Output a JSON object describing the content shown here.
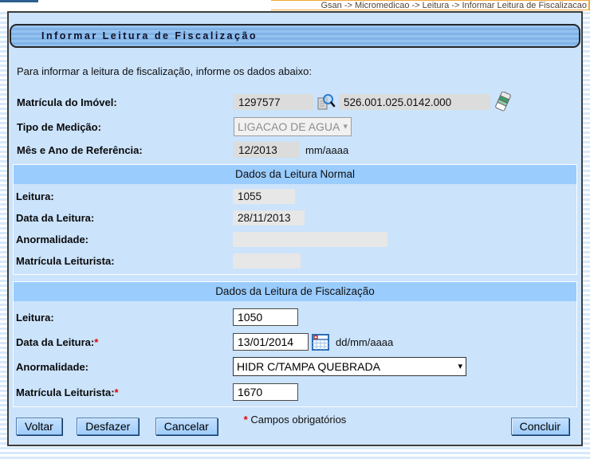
{
  "breadcrumb": "Gsan -> Micromedicao -> Leitura -> Informar Leitura de Fiscalizacao",
  "title_bar": {
    "title": "Informar Leitura de Fiscalização"
  },
  "intro_text": "Para informar a leitura de fiscalização, informe os dados abaixo:",
  "fields": {
    "matricula_imovel": {
      "label": "Matrícula do Imóvel:",
      "value": "1297577",
      "inscricao": "526.001.025.0142.000"
    },
    "tipo_medicao": {
      "label": "Tipo de Medição:",
      "value": "LIGACAO DE AGUA"
    },
    "mes_ano_referencia": {
      "label": "Mês e Ano de Referência:",
      "value": "12/2013",
      "hint": "mm/aaaa"
    }
  },
  "normal_section": {
    "header": "Dados da Leitura Normal",
    "leitura": {
      "label": "Leitura:",
      "value": "1055"
    },
    "data_leitura": {
      "label": "Data da Leitura:",
      "value": "28/11/2013"
    },
    "anormalidade": {
      "label": "Anormalidade:",
      "value": ""
    },
    "matricula_leiturista": {
      "label": "Matrícula Leiturista:",
      "value": ""
    }
  },
  "fiscal_section": {
    "header": "Dados da Leitura de Fiscalização",
    "leitura": {
      "label": "Leitura:",
      "value": "1050"
    },
    "data_leitura": {
      "label": "Data da Leitura:",
      "required": "*",
      "value": "13/01/2014",
      "hint": "dd/mm/aaaa"
    },
    "anormalidade": {
      "label": "Anormalidade:",
      "value": "HIDR C/TAMPA QUEBRADA"
    },
    "matricula_leiturista": {
      "label": "Matrícula Leiturista:",
      "required": "*",
      "value": "1670"
    }
  },
  "footer": {
    "required_marker": "*",
    "required_note": "Campos obrigatórios",
    "buttons": {
      "voltar": "Voltar",
      "desfazer": "Desfazer",
      "cancelar": "Cancelar",
      "concluir": "Concluir"
    }
  },
  "icons": {
    "search": "search-icon",
    "eraser": "eraser-icon",
    "calendar": "calendar-icon",
    "dropdown_arrow": "▾"
  },
  "colors": {
    "page_stripe": "#d7e9fb",
    "panel_bg": "#cbe3fb",
    "panel_border": "#3c3c3c",
    "title_bar_bg": "#8abbe9",
    "section_header_bg": "#9accfe",
    "readonly_field_bg": "#dcdcdc",
    "button_bg": "#a0cdfb",
    "required_color": "#e50000",
    "breadcrumb_line": "#f2a838",
    "top_tab_blue": "#2c5e91"
  }
}
